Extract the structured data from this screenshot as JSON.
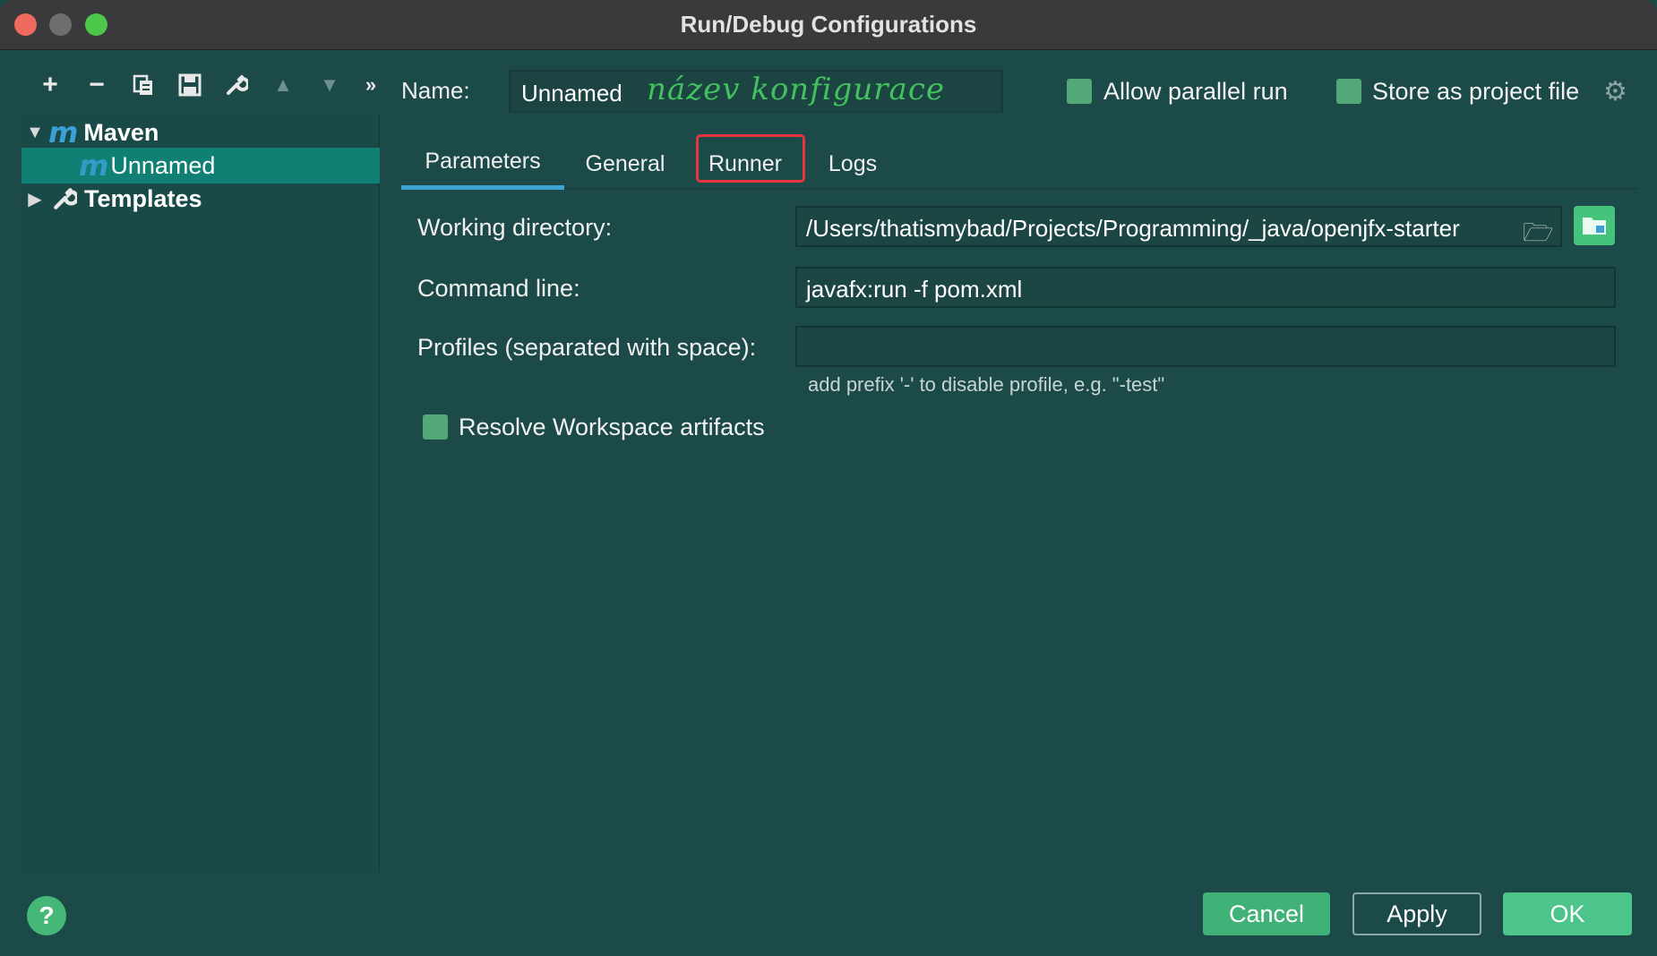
{
  "window": {
    "title": "Run/Debug Configurations"
  },
  "toolbar": {
    "add_icon": "+",
    "remove_icon": "−",
    "more_icon": "»"
  },
  "tree": {
    "maven_label": "Maven",
    "maven_icon": "m",
    "unnamed_label": "Unnamed",
    "unnamed_icon": "m",
    "templates_label": "Templates"
  },
  "header": {
    "name_label": "Name:",
    "name_value": "Unnamed",
    "handwritten_annotation": "název konfigurace",
    "allow_parallel_label": "Allow parallel run",
    "store_project_label": "Store as project file"
  },
  "tabs": [
    {
      "label": "Parameters"
    },
    {
      "label": "General"
    },
    {
      "label": "Runner"
    },
    {
      "label": "Logs"
    }
  ],
  "form": {
    "working_dir_label": "Working directory:",
    "working_dir_value": "/Users/thatismybad/Projects/Programming/_java/openjfx-starter",
    "command_line_label": "Command line:",
    "command_line_value": "javafx:run -f pom.xml",
    "profiles_label": "Profiles (separated with space):",
    "profiles_value": "",
    "profiles_hint": "add prefix '-' to disable profile, e.g. \"-test\"",
    "resolve_label": "Resolve Workspace artifacts"
  },
  "footer": {
    "help_label": "?",
    "cancel_label": "Cancel",
    "apply_label": "Apply",
    "ok_label": "OK"
  },
  "colors": {
    "background": "#1b4a48",
    "selection": "#0f8073",
    "accent_tab": "#3fa3d6",
    "checkbox": "#52a877",
    "primary_button": "#4cc48a",
    "highlight_box": "#e8343f"
  }
}
